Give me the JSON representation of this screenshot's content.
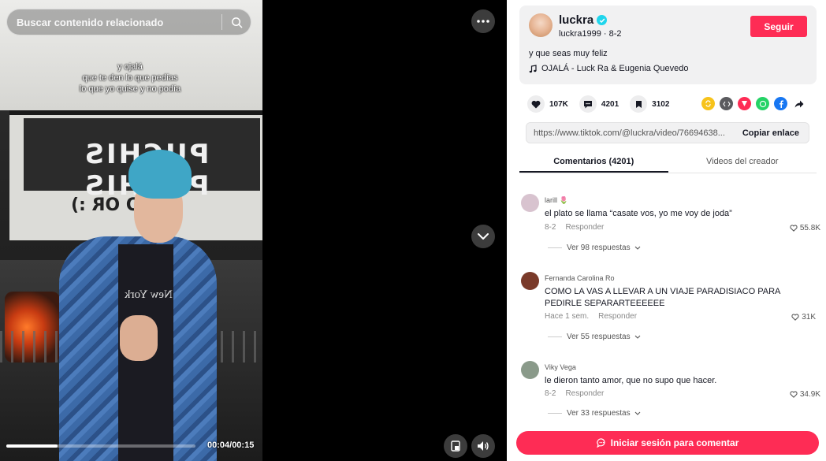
{
  "search": {
    "placeholder": "Buscar contenido relacionado"
  },
  "video": {
    "caption_lines": [
      "y ojalá",
      "que te den lo que pedías",
      "lo que yo quise y no podía"
    ],
    "sign_text": "PUCHIS PUCHIS",
    "sign_sub": "IRO OR :)",
    "shirt_text": "New York",
    "time": "00:04/00:15",
    "progress": 0.27
  },
  "author": {
    "username": "luckra",
    "handle": "luckra1999",
    "date": "8-2",
    "follow_label": "Seguir",
    "description": "y que seas muy feliz",
    "music": "OJALÁ - Luck Ra & Eugenia Quevedo"
  },
  "stats": {
    "likes": "107K",
    "comments": "4201",
    "saves": "3102"
  },
  "link": {
    "url": "https://www.tiktok.com/@luckra/video/76694638...",
    "copy_label": "Copiar enlace"
  },
  "tabs": {
    "comments": "Comentarios (4201)",
    "creator": "Videos del creador"
  },
  "comments": [
    {
      "user": "larill 🌷",
      "text": "el plato se llama “casate vos, yo me voy de joda”",
      "date": "8-2",
      "reply": "Responder",
      "likes": "55.8K",
      "replies": "Ver 98 respuestas",
      "avatar_color": "#d8c3cf"
    },
    {
      "user": "Fernanda Carolina Ro",
      "text": "COMO LA VAS A LLEVAR A UN VIAJE PARADISIACO PARA PEDIRLE SEPARARTEEEEEE",
      "date": "Hace 1 sem.",
      "reply": "Responder",
      "likes": "31K",
      "replies": "Ver 55 respuestas",
      "avatar_color": "#7a3a2a"
    },
    {
      "user": "Viky Vega",
      "text": "le dieron tanto amor, que no supo que hacer.",
      "date": "8-2",
      "reply": "Responder",
      "likes": "34.9K",
      "replies": "Ver 33 respuestas",
      "avatar_color": "#8a9a8a"
    }
  ],
  "login_label": "Iniciar sesión para comentar",
  "colors": {
    "accent": "#fe2c55",
    "verified": "#20d5ec"
  }
}
